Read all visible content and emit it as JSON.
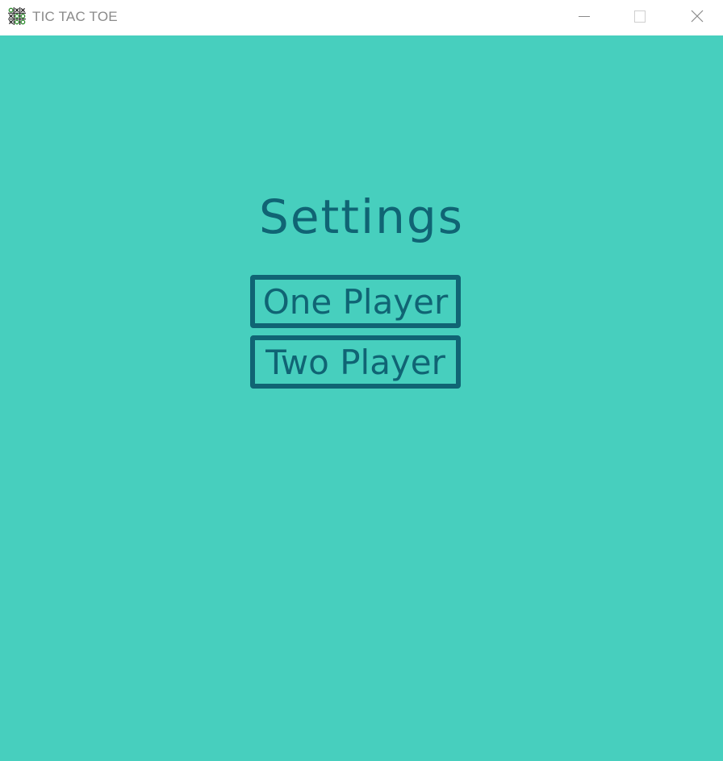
{
  "window": {
    "title": "TIC TAC TOE",
    "app_icon": "tic-tac-toe-board-icon",
    "controls": {
      "minimize_icon": "minimize-icon",
      "maximize_icon": "maximize-icon",
      "close_icon": "close-icon"
    }
  },
  "colors": {
    "background": "#47cfbe",
    "accent": "#106474",
    "titlebar_text": "#8a8a8a"
  },
  "main": {
    "heading": "Settings",
    "buttons": [
      {
        "label": "One Player"
      },
      {
        "label": "Two Player"
      }
    ]
  }
}
